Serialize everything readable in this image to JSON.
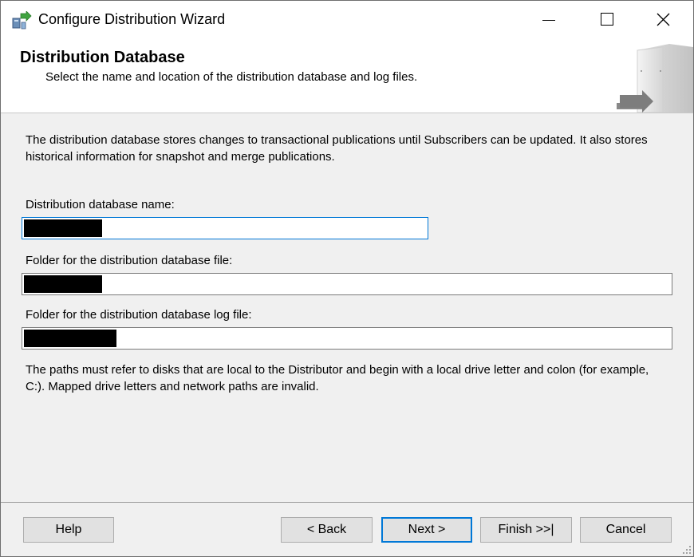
{
  "window": {
    "title": "Configure Distribution Wizard",
    "controls": [
      "minimize-icon",
      "maximize-icon",
      "close-icon"
    ]
  },
  "header": {
    "title": "Distribution Database",
    "subtitle": "Select the name and location of the distribution database and log files."
  },
  "main": {
    "description": "The distribution database stores changes to transactional publications until Subscribers can be updated. It also stores historical information for snapshot and merge publications.",
    "db_name_label": "Distribution database name:",
    "db_name_value": "",
    "db_file_label": "Folder for the distribution database file:",
    "db_file_value": "",
    "log_file_label": "Folder for the distribution database log file:",
    "log_file_value": "",
    "note": "The paths must refer to disks that are local to the Distributor and begin with a local drive letter and colon (for example, C:). Mapped drive letters and network paths are invalid."
  },
  "buttons": {
    "help": "Help",
    "back": "< Back",
    "next": "Next >",
    "finish": "Finish >>|",
    "cancel": "Cancel"
  },
  "colors": {
    "focus_border": "#0078d7",
    "dialog_bg": "#f0f0f0",
    "button_bg": "#e1e1e1"
  }
}
